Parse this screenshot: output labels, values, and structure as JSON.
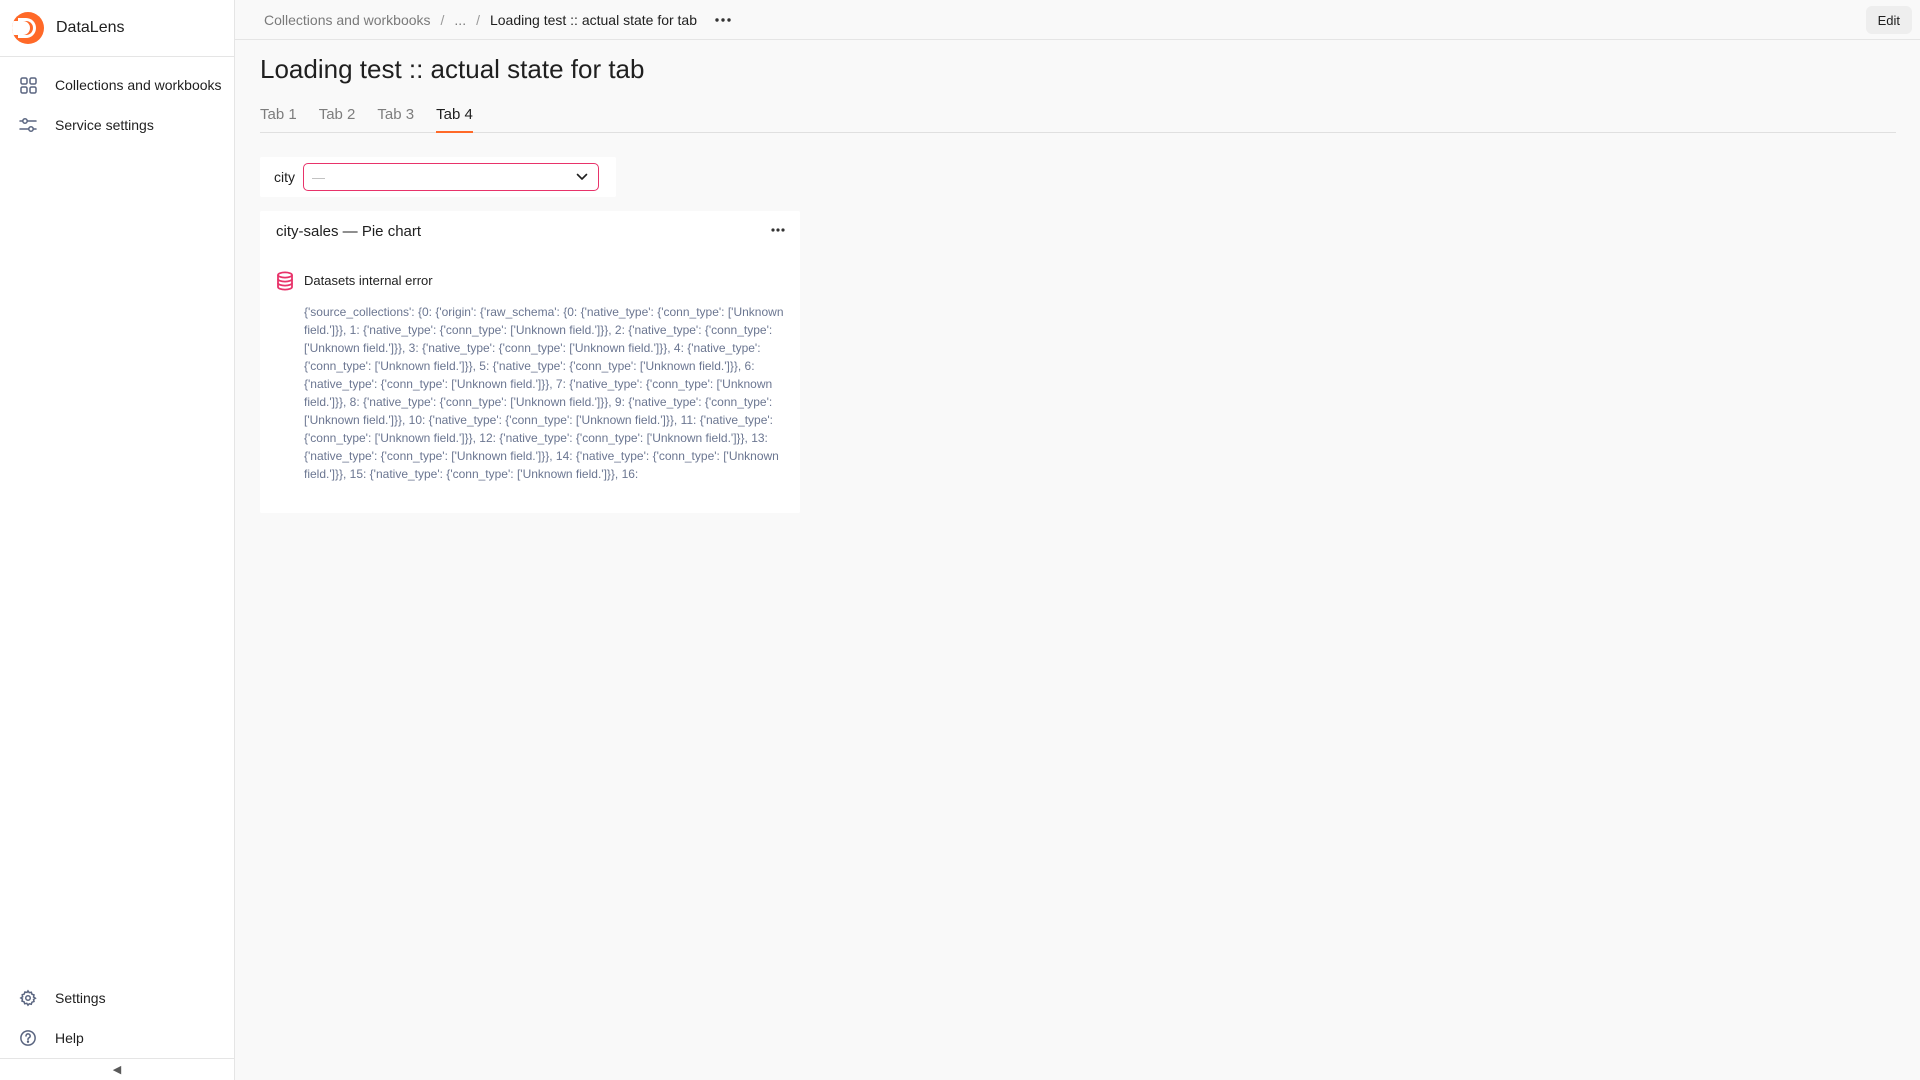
{
  "sidebar": {
    "brand": "DataLens",
    "nav": [
      {
        "label": "Collections and workbooks",
        "icon": "grid-icon"
      },
      {
        "label": "Service settings",
        "icon": "sliders-icon"
      }
    ],
    "bottom": [
      {
        "label": "Settings",
        "icon": "gear-icon"
      },
      {
        "label": "Help",
        "icon": "help-icon"
      }
    ],
    "collapse_glyph": "◀"
  },
  "header": {
    "breadcrumbs": [
      "Collections and workbooks",
      "...",
      "Loading test :: actual state for tab"
    ],
    "separator": "/",
    "edit_label": "Edit"
  },
  "page": {
    "title": "Loading test :: actual state for tab",
    "tabs": [
      "Tab 1",
      "Tab 2",
      "Tab 3",
      "Tab 4"
    ],
    "active_tab": "Tab 4"
  },
  "selector": {
    "label": "city",
    "value": "—"
  },
  "chart_widget": {
    "title": "city-sales — Pie chart",
    "error_title": "Datasets internal error",
    "error_body": "{'source_collections': {0: {'origin': {'raw_schema': {0: {'native_type': {'conn_type': ['Unknown field.']}}, 1: {'native_type': {'conn_type': ['Unknown field.']}}, 2: {'native_type': {'conn_type': ['Unknown field.']}}, 3: {'native_type': {'conn_type': ['Unknown field.']}}, 4: {'native_type': {'conn_type': ['Unknown field.']}}, 5: {'native_type': {'conn_type': ['Unknown field.']}}, 6: {'native_type': {'conn_type': ['Unknown field.']}}, 7: {'native_type': {'conn_type': ['Unknown field.']}}, 8: {'native_type': {'conn_type': ['Unknown field.']}}, 9: {'native_type': {'conn_type': ['Unknown field.']}}, 10: {'native_type': {'conn_type': ['Unknown field.']}}, 11: {'native_type': {'conn_type': ['Unknown field.']}}, 12: {'native_type': {'conn_type': ['Unknown field.']}}, 13: {'native_type': {'conn_type': ['Unknown field.']}}, 14: {'native_type': {'conn_type': ['Unknown field.']}}, 15: {'native_type': {'conn_type': ['Unknown field.']}}, 16:"
  },
  "colors": {
    "accent": "#ff6928",
    "error": "#e8336a",
    "muted_text": "#6b7691"
  }
}
